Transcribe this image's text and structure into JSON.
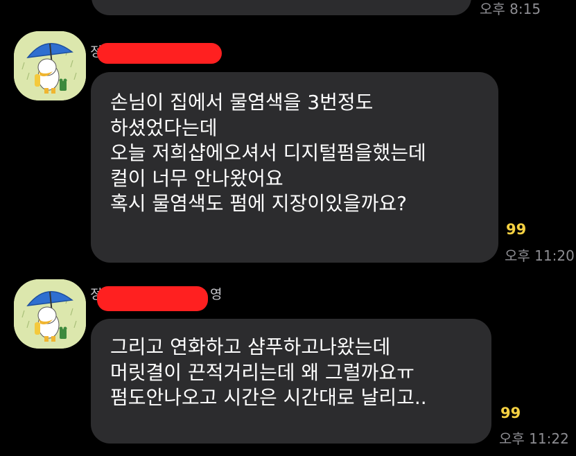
{
  "chat": {
    "previous_message": {
      "time": "오후 8:15"
    },
    "messages": [
      {
        "sender_name_partial": "정",
        "lines": [
          "손님이 집에서 물염색을 3번정도",
          "하셨었다는데",
          "오늘 저희샵에오셔서 디지털펌을했는데",
          "컬이 너무 안나왔어요",
          "혹시 물염색도 펌에 지장이있을까요?"
        ],
        "read_count": "99",
        "time": "오후 11:20"
      },
      {
        "sender_name_partial": "정",
        "sender_name_suffix": "영",
        "lines": [
          "그리고 연화하고 샴푸하고나왔는데",
          "머릿결이 끈적거리는데 왜 그럴까요ㅠ",
          "펌도안나오고 시간은 시간대로 날리고.."
        ],
        "read_count": "99",
        "time": "오후 11:22"
      }
    ]
  },
  "colors": {
    "background": "#000000",
    "bubble": "#2c2c2e",
    "read_count": "#f5d142",
    "time": "#8e8e93",
    "redaction": "#ff2020",
    "avatar_bg": "#dce7ad"
  },
  "icons": {
    "avatar": "duck-with-umbrella-profile-icon"
  }
}
